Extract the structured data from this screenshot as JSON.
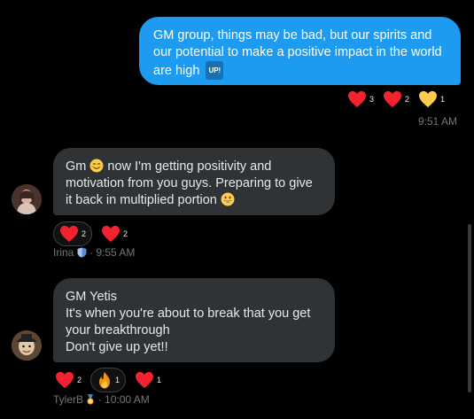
{
  "messages": [
    {
      "text": "GM group, things may be bad, but our spirits and our potential to make a positive impact in the world are high",
      "badge": "UP!",
      "reactions": [
        {
          "emoji": "red-heart",
          "count": "3"
        },
        {
          "emoji": "red-heart",
          "count": "2"
        },
        {
          "emoji": "yellow-heart",
          "count": "1"
        }
      ],
      "meta": "9:51 AM"
    },
    {
      "text_a": "Gm",
      "text_b": "now I'm getting positivity and motivation from you guys. Preparing to give it back in multiplied portion",
      "reactions": [
        {
          "emoji": "red-heart",
          "count": "2"
        },
        {
          "emoji": "red-heart",
          "count": "2"
        }
      ],
      "author": "Irina",
      "meta": "· 9:55 AM"
    },
    {
      "lines": [
        "GM Yetis",
        "It's when you're about to break that you get your breakthrough",
        "Don't give up yet!!"
      ],
      "reactions": [
        {
          "emoji": "red-heart",
          "count": "2"
        },
        {
          "emoji": "fire",
          "count": "1"
        },
        {
          "emoji": "red-heart",
          "count": "1"
        }
      ],
      "author": "TylerB",
      "meta": "· 10:00 AM"
    }
  ],
  "colors": {
    "outgoing_bubble": "#1d9bf0",
    "incoming_bubble": "#2f3336",
    "heart": "#f4212e"
  }
}
